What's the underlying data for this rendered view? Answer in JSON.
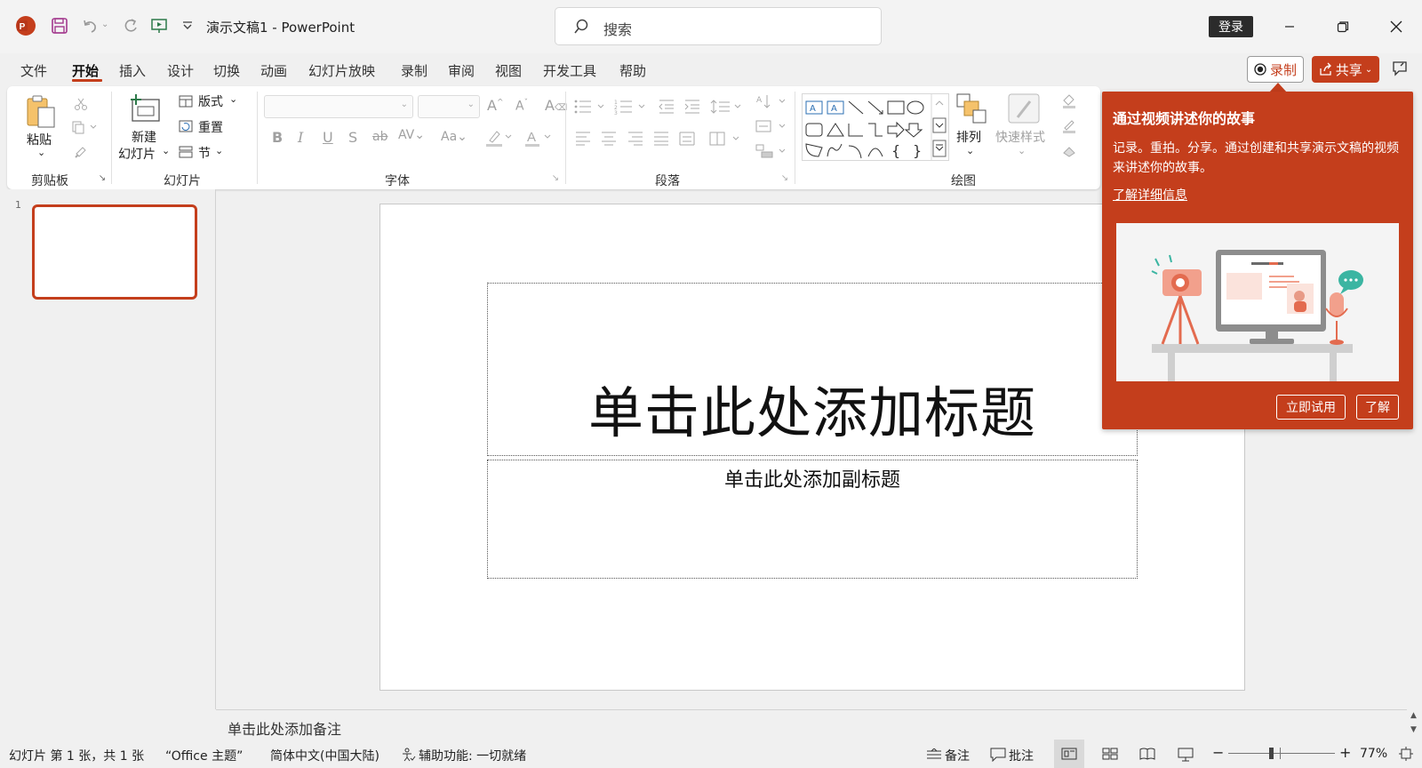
{
  "app": {
    "doc_title": "演示文稿1  -  PowerPoint",
    "login": "登录"
  },
  "search": {
    "placeholder": "搜索"
  },
  "tabs": [
    {
      "label": "文件"
    },
    {
      "label": "开始"
    },
    {
      "label": "插入"
    },
    {
      "label": "设计"
    },
    {
      "label": "切换"
    },
    {
      "label": "动画"
    },
    {
      "label": "幻灯片放映"
    },
    {
      "label": "录制"
    },
    {
      "label": "审阅"
    },
    {
      "label": "视图"
    },
    {
      "label": "开发工具"
    },
    {
      "label": "帮助"
    }
  ],
  "actions": {
    "record": "录制",
    "share": "共享"
  },
  "ribbon": {
    "clipboard": {
      "paste": "粘贴",
      "group": "剪贴板"
    },
    "slides": {
      "new_slide_1": "新建",
      "new_slide_2": "幻灯片",
      "layout": "版式",
      "reset": "重置",
      "section": "节",
      "group": "幻灯片"
    },
    "font": {
      "group": "字体"
    },
    "paragraph": {
      "group": "段落"
    },
    "drawing": {
      "arrange": "排列",
      "quick_styles": "快速样式",
      "group": "绘图"
    }
  },
  "slide": {
    "title": "单击此处添加标题",
    "subtitle": "单击此处添加副标题",
    "thumb_number": "1"
  },
  "notes": {
    "placeholder": "单击此处添加备注"
  },
  "status": {
    "slide_info": "幻灯片 第 1 张，共 1 张",
    "theme": "“Office 主题”",
    "language": "简体中文(中国大陆)",
    "accessibility": "辅助功能: 一切就绪",
    "notes": "备注",
    "comments": "批注",
    "zoom": "77%"
  },
  "popup": {
    "title": "通过视频讲述你的故事",
    "desc": "记录。重拍。分享。通过创建和共享演示文稿的视频来讲述你的故事。",
    "link": "了解详细信息",
    "try_now": "立即试用",
    "got_it": "了解"
  },
  "colors": {
    "accent": "#c43e1c",
    "popup_bg": "#c43e1c",
    "login_bg": "#2b2b2b"
  }
}
